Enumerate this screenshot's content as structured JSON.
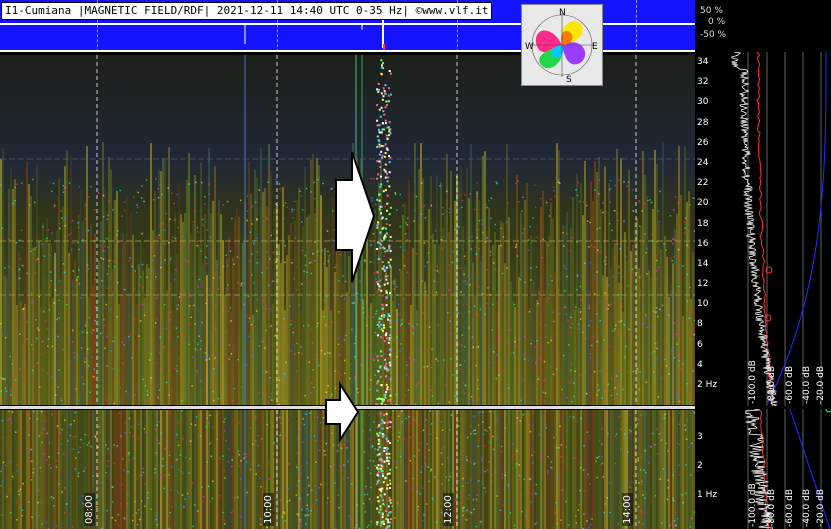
{
  "header": {
    "title": "I1-Cumiana |MAGNETIC FIELD/RDF| 2021-12-11 14:40 UTC 0-35 Hz| ©www.vlf.it"
  },
  "level_scale": {
    "labels": [
      "50 %",
      "0 %",
      "-50 %"
    ]
  },
  "compass": {
    "n": "N",
    "e": "E",
    "s": "S",
    "w": "W"
  },
  "freq_axis_top": {
    "ticks": [
      "34",
      "32",
      "30",
      "28",
      "26",
      "24",
      "22",
      "20",
      "18",
      "16",
      "14",
      "12",
      "10",
      "8",
      "6",
      "4",
      "2 Hz"
    ]
  },
  "freq_axis_bottom": {
    "ticks": [
      "3",
      "2",
      "1 Hz"
    ]
  },
  "time_axis": {
    "labels": [
      "08:00",
      "10:00",
      "12:00",
      "14:00"
    ]
  },
  "db_axis": {
    "labels": [
      "-100.0 dB",
      "-80.0 dB",
      "-60.0 dB",
      "-40.0 dB",
      "-20.0 dB"
    ]
  },
  "colors": {
    "strip_blue": "#1414ff",
    "spectrum_trace": "#ffffff",
    "reference_trace": "#ff3030",
    "envelope": "#2a2aff"
  }
}
